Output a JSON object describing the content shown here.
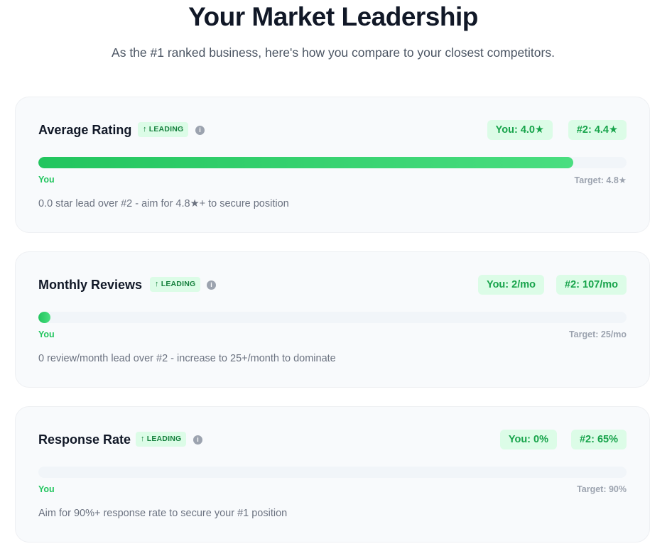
{
  "header": {
    "title": "Your Market Leadership",
    "subtitle": "As the #1 ranked business, here's how you compare to your closest competitors."
  },
  "metrics": [
    {
      "title": "Average Rating",
      "badge": "LEADING",
      "you": "You: 4.0★",
      "second": "#2: 4.4★",
      "progress_fraction": 0.91,
      "you_label": "You",
      "target_label": "Target: 4.8★",
      "note": "0.0 star lead over #2 - aim for 4.8★+ to secure position"
    },
    {
      "title": "Monthly Reviews",
      "badge": "LEADING",
      "you": "You: 2/mo",
      "second": "#2: 107/mo",
      "progress_fraction": 0.02,
      "you_label": "You",
      "target_label": "Target: 25/mo",
      "note": "0 review/month lead over #2 - increase to 25+/month to dominate"
    },
    {
      "title": "Response Rate",
      "badge": "LEADING",
      "you": "You: 0%",
      "second": "#2: 65%",
      "progress_fraction": 0,
      "you_label": "You",
      "target_label": "Target: 90%",
      "note": "Aim for 90%+ response rate to secure your #1 position"
    }
  ],
  "colors": {
    "accent": "#22c55e",
    "badge_bg": "#dcfce7",
    "badge_text": "#15803d",
    "card_bg": "#f8fafc"
  },
  "icons": {
    "badge_arrow": "arrow-up-icon",
    "info": "info-icon"
  }
}
